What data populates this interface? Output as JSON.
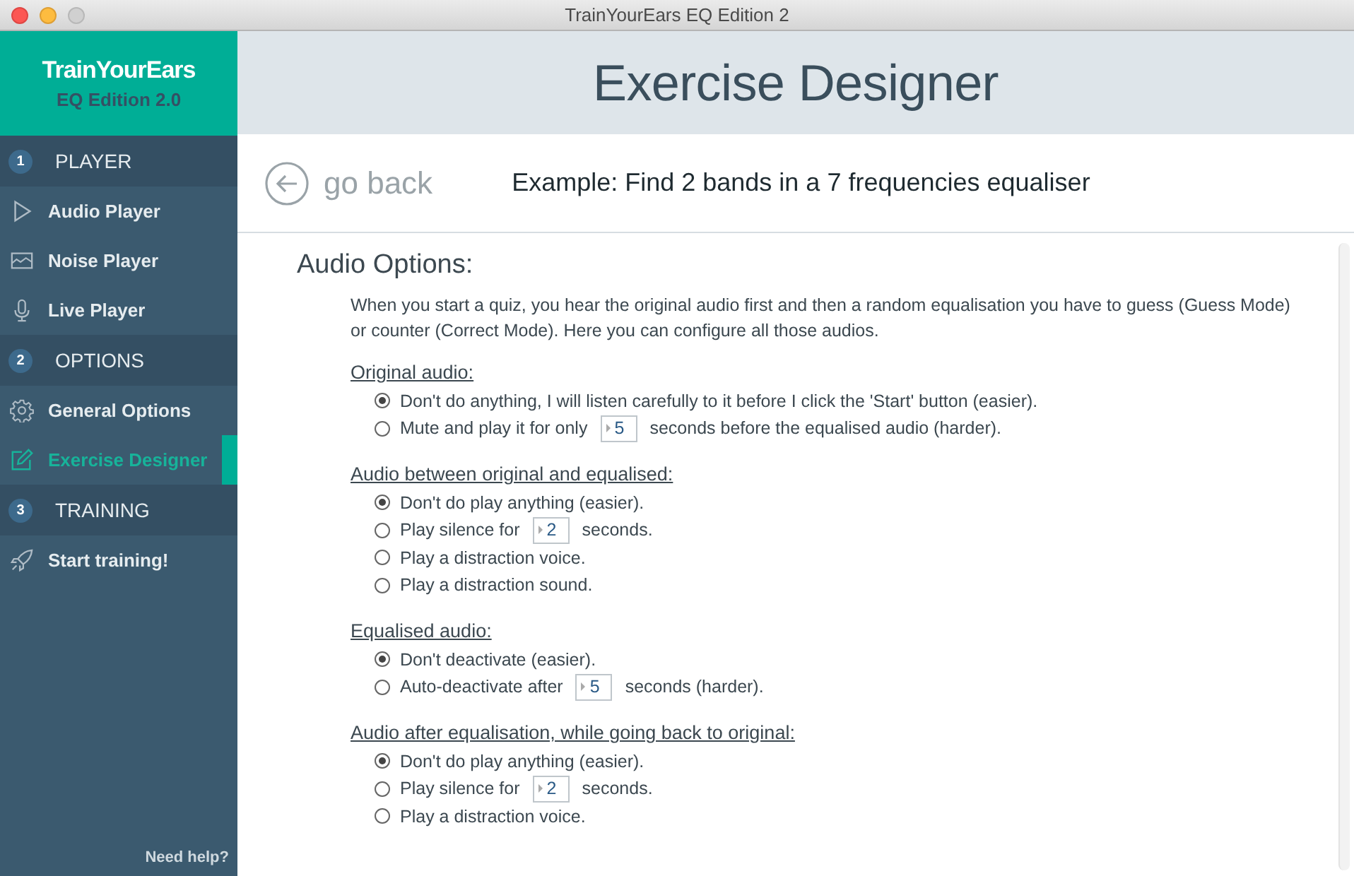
{
  "window": {
    "title": "TrainYourEars EQ Edition 2"
  },
  "brand": {
    "name": "TrainYourEars",
    "edition": "EQ Edition 2.0"
  },
  "sidebar": {
    "sections": [
      {
        "number": "1",
        "label": "PLAYER",
        "items": [
          {
            "label": "Audio Player",
            "kind": "play",
            "selected": false
          },
          {
            "label": "Noise Player",
            "kind": "noise",
            "selected": false
          },
          {
            "label": "Live Player",
            "kind": "mic",
            "selected": false
          }
        ]
      },
      {
        "number": "2",
        "label": "OPTIONS",
        "items": [
          {
            "label": "General Options",
            "kind": "gear",
            "selected": false
          },
          {
            "label": "Exercise Designer",
            "kind": "edit",
            "selected": true
          }
        ]
      },
      {
        "number": "3",
        "label": "TRAINING",
        "items": [
          {
            "label": "Start training!",
            "kind": "rocket",
            "selected": false
          }
        ]
      }
    ],
    "help": "Need help?"
  },
  "header": {
    "title": "Exercise Designer"
  },
  "nav": {
    "back": "go back",
    "exercise": "Example: Find 2 bands in a 7 frequencies equaliser"
  },
  "content": {
    "heading": "Audio Options:",
    "intro": "When you start a quiz, you hear the original audio first and then a random equalisation you have to guess (Guess Mode) or counter (Correct Mode). Here you can configure all those audios.",
    "groups": [
      {
        "title": "Original audio:",
        "options": [
          {
            "kind": "plain",
            "label": "Don't do anything, I will listen carefully to it before I click the 'Start' button (easier).",
            "selected": true
          },
          {
            "kind": "number",
            "before": "Mute and play it for only",
            "value": "5",
            "after": "seconds before the equalised audio (harder).",
            "selected": false
          }
        ]
      },
      {
        "title": "Audio between original and equalised:",
        "options": [
          {
            "kind": "plain",
            "label": "Don't do play anything (easier).",
            "selected": true
          },
          {
            "kind": "number",
            "before": "Play silence for",
            "value": "2",
            "after": "seconds.",
            "selected": false
          },
          {
            "kind": "plain",
            "label": "Play a distraction voice.",
            "selected": false
          },
          {
            "kind": "plain",
            "label": "Play a distraction sound.",
            "selected": false
          }
        ]
      },
      {
        "title": "Equalised audio:",
        "options": [
          {
            "kind": "plain",
            "label": "Don't deactivate (easier).",
            "selected": true
          },
          {
            "kind": "number",
            "before": "Auto-deactivate after",
            "value": "5",
            "after": "seconds (harder).",
            "selected": false
          }
        ]
      },
      {
        "title": "Audio after equalisation, while going back to original:",
        "options": [
          {
            "kind": "plain",
            "label": "Don't do play anything (easier).",
            "selected": true
          },
          {
            "kind": "number",
            "before": "Play silence for",
            "value": "2",
            "after": "seconds.",
            "selected": false
          },
          {
            "kind": "plain",
            "label": "Play a distraction voice.",
            "selected": false
          }
        ]
      }
    ]
  }
}
